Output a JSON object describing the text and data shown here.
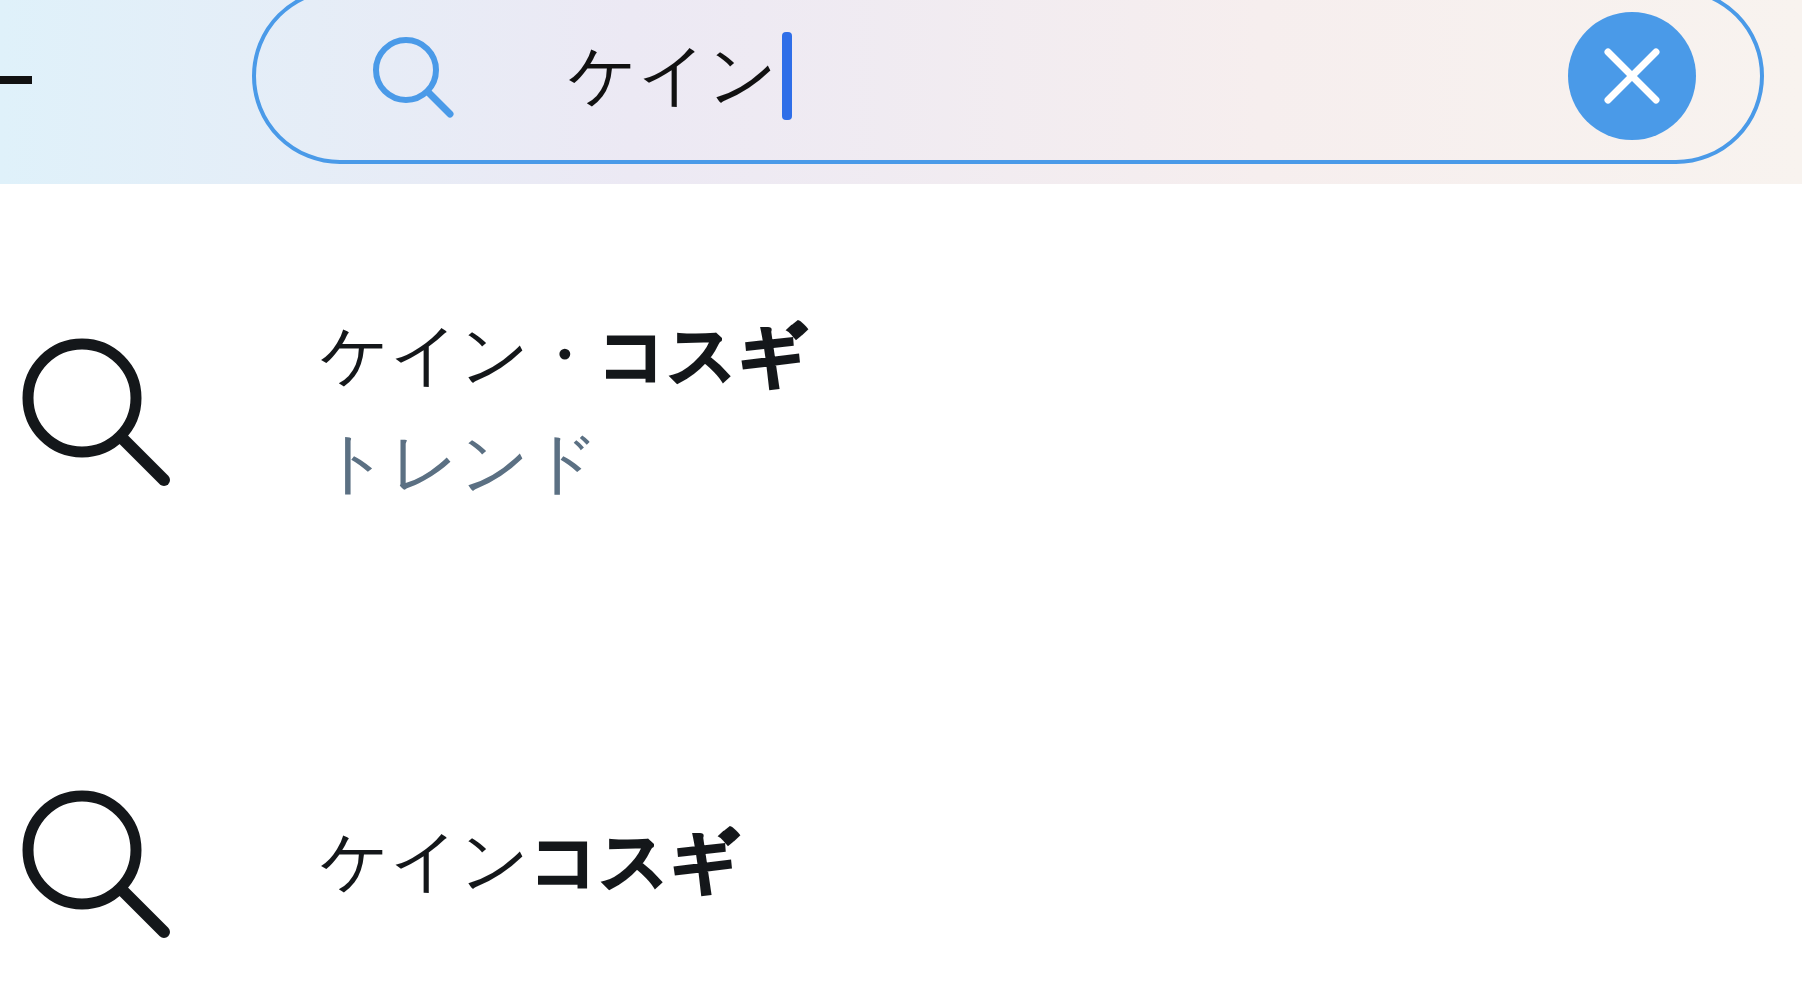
{
  "search": {
    "value": "ケイン",
    "cursor": true
  },
  "suggestions": [
    {
      "text": "ケイン・**コスギ**",
      "subtitle": "トレンド"
    },
    {
      "text": "ケイン**コスギ**"
    }
  ]
}
